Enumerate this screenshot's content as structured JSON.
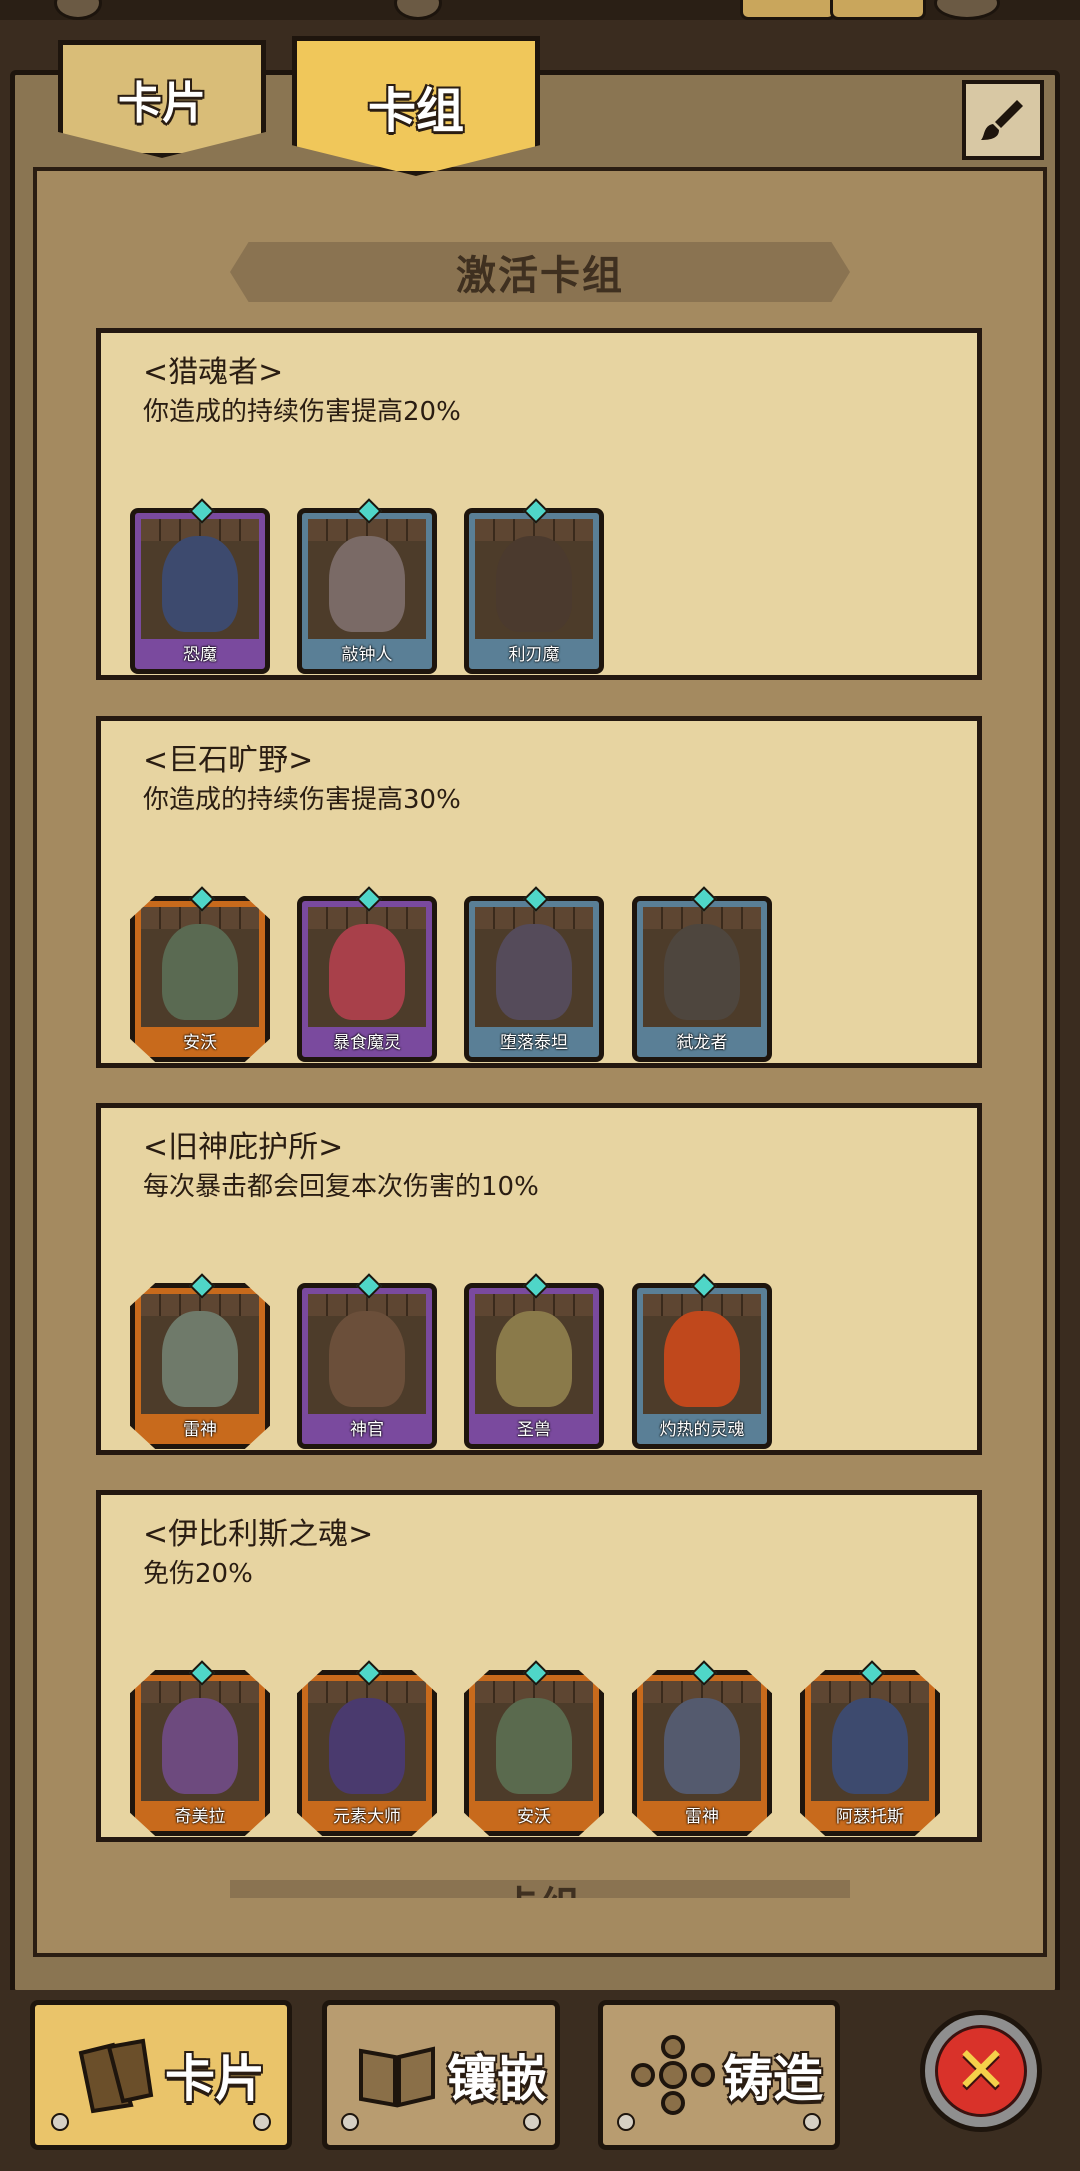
{
  "top_tabs": {
    "cards": "卡片",
    "deck": "卡组"
  },
  "section_title": "激活卡组",
  "next_section_partial": "卡组",
  "decks": [
    {
      "name": "<猎魂者>",
      "effect": "你造成的持续伤害提高20%",
      "cards": [
        {
          "name": "恐魔",
          "rarity": "purple"
        },
        {
          "name": "敲钟人",
          "rarity": "blue"
        },
        {
          "name": "利刃魔",
          "rarity": "blue"
        }
      ]
    },
    {
      "name": "<巨石旷野>",
      "effect": "你造成的持续伤害提高30%",
      "cards": [
        {
          "name": "安沃",
          "rarity": "orange"
        },
        {
          "name": "暴食魔灵",
          "rarity": "purple"
        },
        {
          "name": "堕落泰坦",
          "rarity": "blue"
        },
        {
          "name": "弑龙者",
          "rarity": "blue"
        }
      ]
    },
    {
      "name": "<旧神庇护所>",
      "effect": "每次暴击都会回复本次伤害的10%",
      "cards": [
        {
          "name": "雷神",
          "rarity": "orange"
        },
        {
          "name": "神官",
          "rarity": "purple"
        },
        {
          "name": "圣兽",
          "rarity": "purple"
        },
        {
          "name": "灼热的灵魂",
          "rarity": "blue"
        }
      ]
    },
    {
      "name": "<伊比利斯之魂>",
      "effect": "免伤20%",
      "cards": [
        {
          "name": "奇美拉",
          "rarity": "orange"
        },
        {
          "name": "元素大师",
          "rarity": "orange"
        },
        {
          "name": "安沃",
          "rarity": "orange"
        },
        {
          "name": "雷神",
          "rarity": "orange"
        },
        {
          "name": "阿瑟托斯",
          "rarity": "orange"
        }
      ]
    }
  ],
  "bottom_nav": {
    "cards": "卡片",
    "inlay": "镶嵌",
    "forge": "铸造"
  },
  "colors": {
    "purple": "#7a4a9e",
    "blue": "#5a7f96",
    "orange": "#c86a1c",
    "tab_active": "#f0c75a",
    "close": "#d9322a"
  },
  "icons": {
    "edit": "brush-icon",
    "close": "close-icon",
    "cards": "cards-icon",
    "inlay": "book-icon",
    "forge": "cross-icon"
  }
}
